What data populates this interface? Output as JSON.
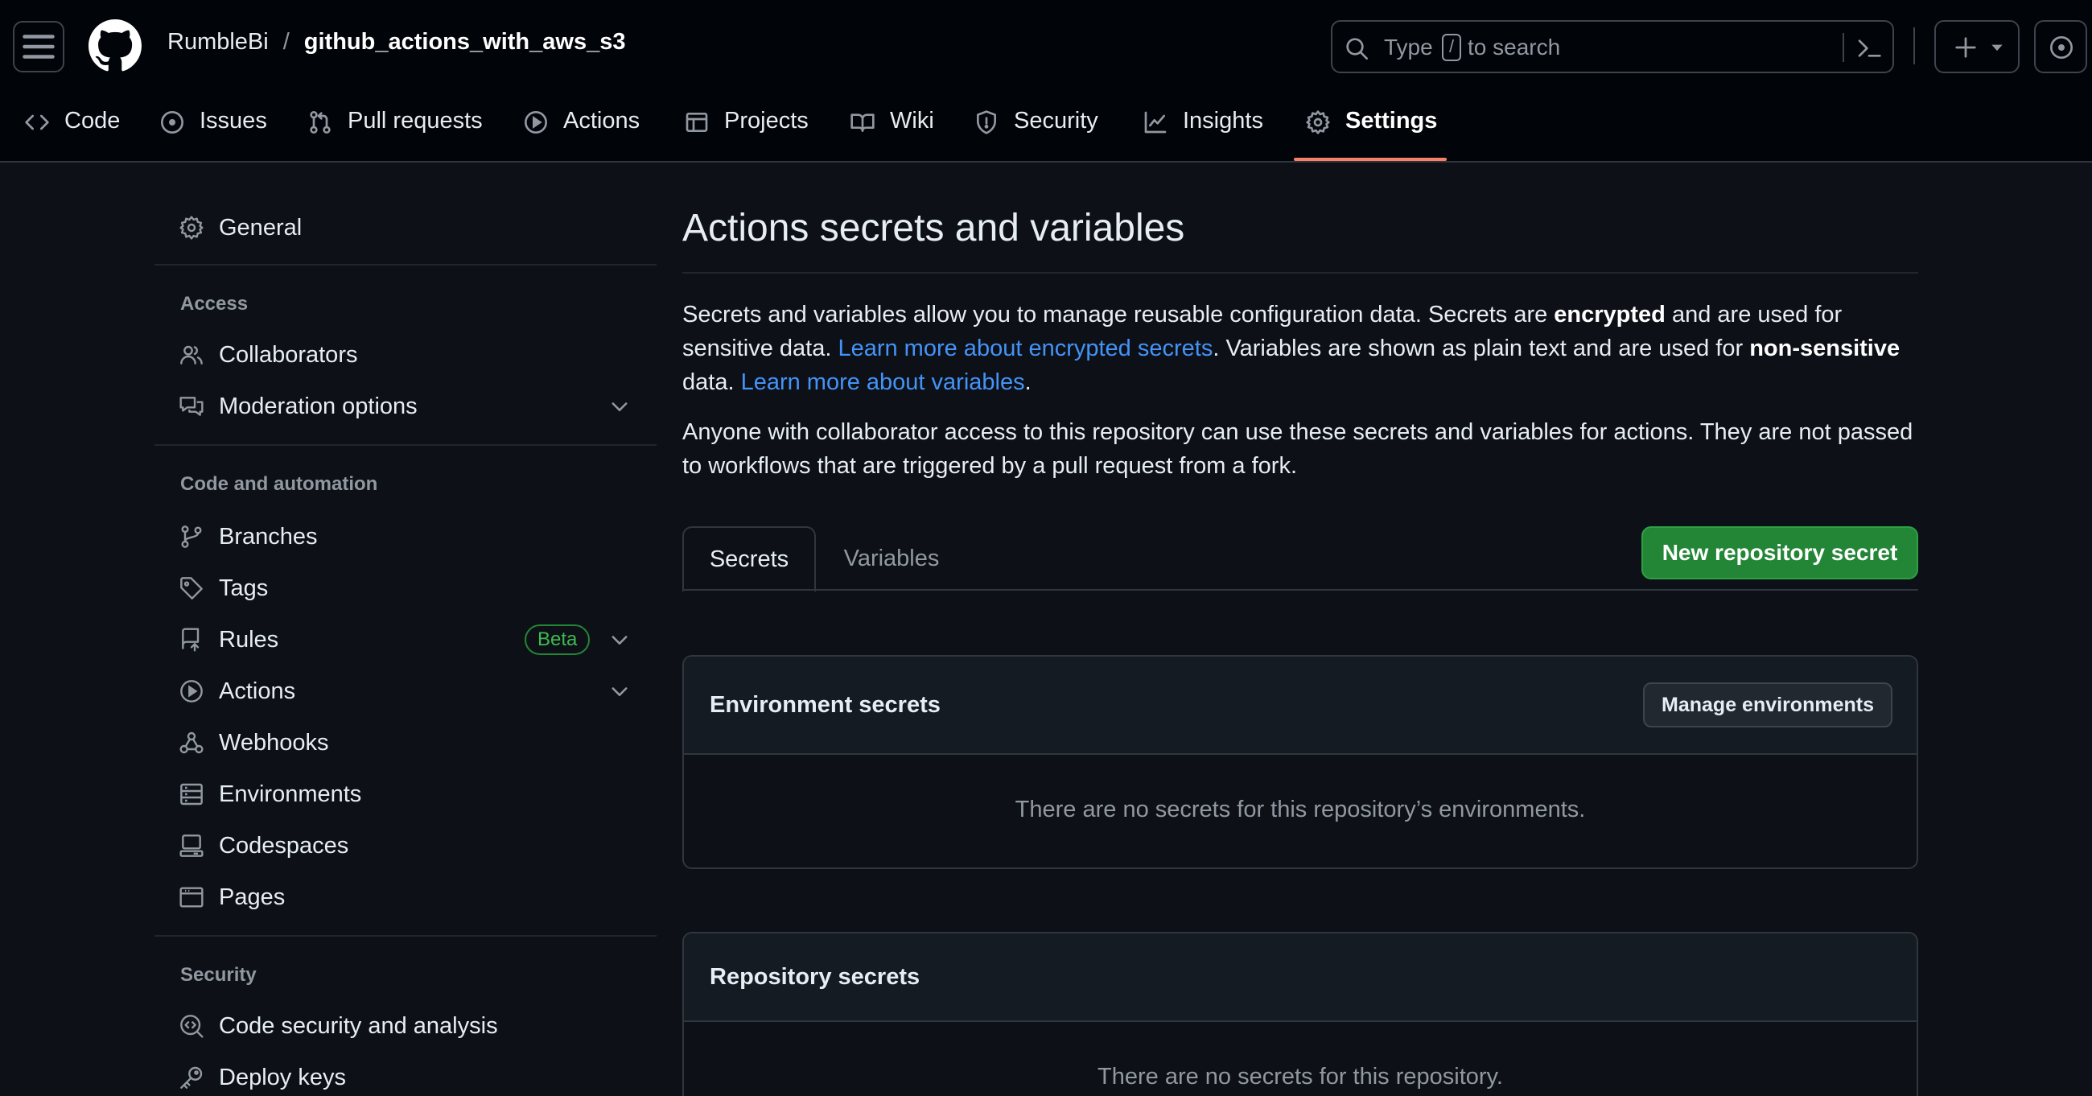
{
  "header": {
    "owner": "RumbleBi",
    "separator": "/",
    "repo": "github_actions_with_aws_s3",
    "search": {
      "prefix": "Type",
      "key": "/",
      "suffix": "to search"
    }
  },
  "nav_tabs": [
    {
      "label": "Code",
      "icon": "code-icon"
    },
    {
      "label": "Issues",
      "icon": "issue-opened-icon"
    },
    {
      "label": "Pull requests",
      "icon": "git-pull-request-icon"
    },
    {
      "label": "Actions",
      "icon": "play-icon"
    },
    {
      "label": "Projects",
      "icon": "table-icon"
    },
    {
      "label": "Wiki",
      "icon": "book-icon"
    },
    {
      "label": "Security",
      "icon": "shield-icon"
    },
    {
      "label": "Insights",
      "icon": "graph-icon"
    },
    {
      "label": "Settings",
      "icon": "gear-icon",
      "active": true
    }
  ],
  "sidebar": {
    "general": "General",
    "access_heading": "Access",
    "access": [
      "Collaborators",
      "Moderation options"
    ],
    "code_heading": "Code and automation",
    "code": [
      "Branches",
      "Tags",
      "Rules",
      "Actions",
      "Webhooks",
      "Environments",
      "Codespaces",
      "Pages"
    ],
    "rules_badge": "Beta",
    "security_heading": "Security",
    "security": [
      "Code security and analysis",
      "Deploy keys"
    ]
  },
  "main": {
    "title": "Actions secrets and variables",
    "intro": {
      "t1": "Secrets and variables allow you to manage reusable configuration data. Secrets are ",
      "b1": "encrypted",
      "t2": " and are used for sensitive data. ",
      "link1": "Learn more about encrypted secrets",
      "t3": ". Variables are shown as plain text and are used for ",
      "b2": "non-sensitive",
      "t4": " data. ",
      "link2": "Learn more about variables",
      "t5": "."
    },
    "note": "Anyone with collaborator access to this repository can use these secrets and variables for actions. They are not passed to workflows that are triggered by a pull request from a fork.",
    "tabs": {
      "secrets": "Secrets",
      "variables": "Variables"
    },
    "new_secret_button": "New repository secret",
    "environment_secrets": {
      "title": "Environment secrets",
      "manage_button": "Manage environments",
      "empty": "There are no secrets for this repository’s environments."
    },
    "repository_secrets": {
      "title": "Repository secrets",
      "empty": "There are no secrets for this repository."
    }
  },
  "colors": {
    "accent_underline": "#f78166",
    "primary_button": "#238636",
    "link": "#4493f8",
    "beta_badge": "#3fb950"
  }
}
